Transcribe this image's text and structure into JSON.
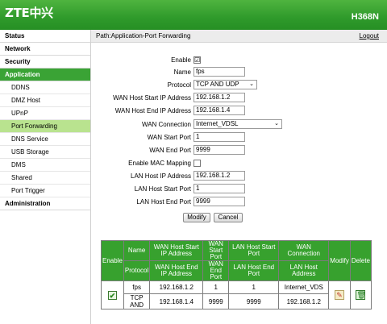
{
  "header": {
    "logo": "ZTE中兴",
    "model": "H368N"
  },
  "menu": {
    "top_items": [
      {
        "label": "Status"
      },
      {
        "label": "Network"
      },
      {
        "label": "Security"
      },
      {
        "label": "Application"
      }
    ],
    "sub_items": [
      {
        "label": "DDNS"
      },
      {
        "label": "DMZ Host"
      },
      {
        "label": "UPnP"
      },
      {
        "label": "Port Forwarding"
      },
      {
        "label": "DNS Service"
      },
      {
        "label": "USB Storage"
      },
      {
        "label": "DMS"
      },
      {
        "label": "Shared"
      },
      {
        "label": "Port Trigger"
      }
    ],
    "bottom_item": {
      "label": "Administration"
    }
  },
  "pathbar": {
    "path": "Path:Application-Port Forwarding",
    "logout": "Logout"
  },
  "form": {
    "enable_label": "Enable",
    "enable_checked": "☑",
    "name_label": "Name",
    "name_value": "fps",
    "protocol_label": "Protocol",
    "protocol_value": "TCP AND UDP",
    "wan_start_ip_label": "WAN Host Start IP Address",
    "wan_start_ip_value": "192.168.1.2",
    "wan_end_ip_label": "WAN Host End IP Address",
    "wan_end_ip_value": "192.168.1.4",
    "wan_conn_label": "WAN Connection",
    "wan_conn_value": "Internet_VDSL",
    "wan_start_port_label": "WAN Start Port",
    "wan_start_port_value": "1",
    "wan_end_port_label": "WAN End Port",
    "wan_end_port_value": "9999",
    "mac_label": "Enable MAC Mapping",
    "lan_ip_label": "LAN Host IP Address",
    "lan_ip_value": "192.168.1.2",
    "lan_start_port_label": "LAN Host Start Port",
    "lan_start_port_value": "1",
    "lan_end_port_label": "LAN Host End Port",
    "lan_end_port_value": "9999",
    "modify_label": "Modify",
    "cancel_label": "Cancel"
  },
  "table": {
    "h_enable": "Enable",
    "h_name": "Name",
    "h_wan_start_ip": "WAN Host Start IP Address",
    "h_wan_start_port": "WAN Start Port",
    "h_lan_start_port": "LAN Host Start Port",
    "h_wan_conn": "WAN Connection",
    "h_modify": "Modify",
    "h_delete": "Delete",
    "h_protocol": "Protocol",
    "h_wan_end_ip": "WAN Host End IP Address",
    "h_wan_end_port": "WAN End Port",
    "h_lan_end_port": "LAN Host End Port",
    "h_lan_ip": "LAN Host Address",
    "row": {
      "name": "fps",
      "wan_start_ip": "192.168.1.2",
      "wan_start_port": "1",
      "lan_start_port": "1",
      "wan_conn": "Internet_VDS",
      "protocol": "TCP AND",
      "wan_end_ip": "192.168.1.4",
      "wan_end_port": "9999",
      "lan_end_port": "9999",
      "lan_ip": "192.168.1.2"
    }
  },
  "colors": {
    "brand_green": "#37a12e",
    "selected_sub": "#b9e38f"
  }
}
